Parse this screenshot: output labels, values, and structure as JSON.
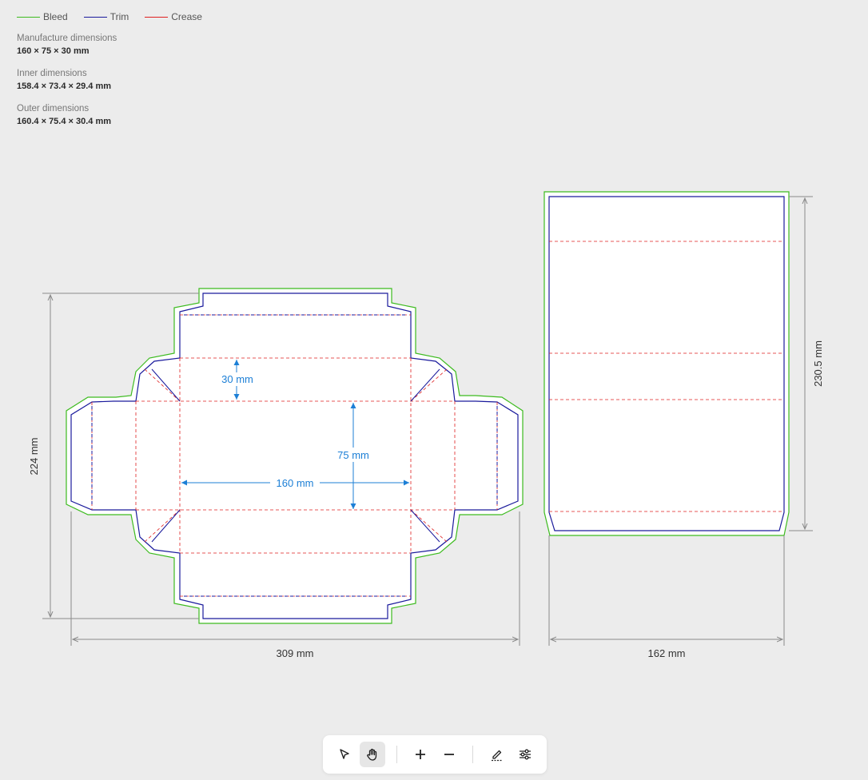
{
  "legend": [
    {
      "label": "Bleed",
      "color": "#3dbb1f"
    },
    {
      "label": "Trim",
      "color": "#1a1a9c"
    },
    {
      "label": "Crease",
      "color": "#e02020"
    }
  ],
  "info": [
    {
      "label": "Manufacture dimensions",
      "value": "160 × 75 × 30 mm"
    },
    {
      "label": "Inner dimensions",
      "value": "158.4 × 73.4 × 29.4 mm"
    },
    {
      "label": "Outer dimensions",
      "value": "160.4 × 75.4 × 30.4 mm"
    }
  ],
  "dimensions": {
    "tray_height": "224 mm",
    "tray_width": "309 mm",
    "sleeve_width": "162 mm",
    "sleeve_height": "230.5 mm",
    "inner_length": "160 mm",
    "inner_width": "75 mm",
    "inner_height": "30 mm"
  },
  "toolbar": {
    "tools": [
      {
        "name": "select-tool",
        "icon": "cursor-icon",
        "active": false
      },
      {
        "name": "pan-tool",
        "icon": "hand-icon",
        "active": true
      },
      {
        "name": "zoom-in",
        "icon": "plus-icon",
        "active": false
      },
      {
        "name": "zoom-out",
        "icon": "minus-icon",
        "active": false
      },
      {
        "name": "edit-tool",
        "icon": "pen-icon",
        "active": false
      },
      {
        "name": "settings-tool",
        "icon": "sliders-icon",
        "active": false
      }
    ]
  },
  "colors": {
    "bleed": "#3dbb1f",
    "trim": "#1a1a9c",
    "crease": "#e02020",
    "dimension": "#8a8a8a",
    "annotation": "#1c7fd6"
  }
}
